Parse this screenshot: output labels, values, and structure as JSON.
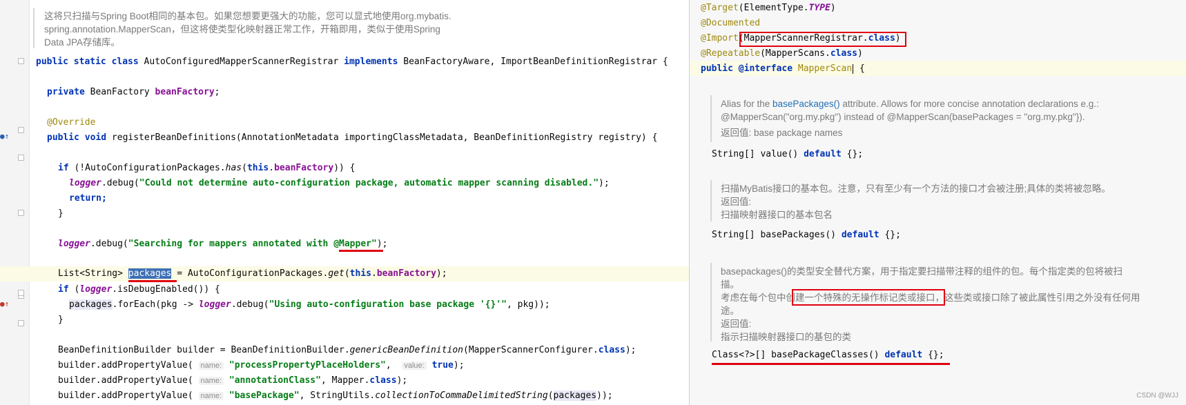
{
  "left_doc": {
    "line1": "这将只扫描与Spring Boot相同的基本包。如果您想要更强大的功能，您可以显式地使用org.mybatis.",
    "line2": "spring.annotation.MapperScan，但这将使类型化映射器正常工作，开箱即用，类似于使用Spring",
    "line3": "Data JPA存储库。"
  },
  "code": {
    "class_decl": {
      "k1": "public static class",
      "name": "AutoConfiguredMapperScannerRegistrar",
      "k2": "implements",
      "rest": "BeanFactoryAware, ImportBeanDefinitionRegistrar {"
    },
    "field": {
      "k": "private",
      "type": "BeanFactory",
      "name": "beanFactory",
      "end": ";"
    },
    "override": "@Override",
    "method_decl": {
      "k": "public void",
      "rest": "registerBeanDefinitions(AnnotationMetadata importingClassMetadata, BeanDefinitionRegistry registry) {"
    },
    "if1": {
      "k": "if",
      "a": "(!AutoConfigurationPackages.",
      "m": "has",
      "b": "(",
      "this": "this",
      "dot": ".",
      "f": "beanFactory",
      "c": ")) {"
    },
    "debug1": {
      "logger": "logger",
      "a": ".debug(",
      "s": "\"Could not determine auto-configuration package, automatic mapper scanning disabled.\"",
      "b": ");"
    },
    "return": "return;",
    "close1": "}",
    "debug2": {
      "logger": "logger",
      "a": ".debug(",
      "s1": "\"Searching for mappers annotated with ",
      "s2": "@Mapper",
      "s3": "\"",
      "b": ");"
    },
    "list": {
      "a": "List<String> ",
      "v": "packages",
      "b": " = AutoConfigurationPackages.",
      "m": "get",
      "c": "(",
      "this": "this",
      "dot": ".",
      "f": "beanFactory",
      "d": ");"
    },
    "if2": {
      "k": "if",
      "a": " (",
      "logger": "logger",
      "b": ".isDebugEnabled()) {"
    },
    "foreach": {
      "v": "packages",
      "a": ".forEach(pkg -> ",
      "logger": "logger",
      "b": ".debug(",
      "s": "\"Using auto-configuration base package '{}'\"",
      "c": ", pkg));"
    },
    "close2": "}",
    "builder1": {
      "a": "BeanDefinitionBuilder builder = BeanDefinitionBuilder.",
      "m": "genericBeanDefinition",
      "b": "(MapperScannerConfigurer.",
      "k": "class",
      "c": ");"
    },
    "builder2": {
      "a": "builder.addPropertyValue( ",
      "h1": "name:",
      "s": "\"processPropertyPlaceHolders\"",
      "sep": ",  ",
      "h2": "value:",
      "k": "true",
      "b": ");"
    },
    "builder3": {
      "a": "builder.addPropertyValue( ",
      "h1": "name:",
      "s": "\"annotationClass\"",
      "b": ", Mapper.",
      "k": "class",
      "c": ");"
    },
    "builder4": {
      "a": "builder.addPropertyValue( ",
      "h1": "name:",
      "s": "\"basePackage\"",
      "b": ", StringUtils.",
      "m": "collectionToCommaDelimitedString",
      "c": "(",
      "v": "packages",
      "d": "));"
    }
  },
  "right": {
    "ann1": {
      "a": "@Target",
      "b": "(ElementType.",
      "c": "TYPE",
      "d": ")"
    },
    "ann2": "@Documented",
    "ann3": {
      "a": "@Import",
      "b": "(MapperScannerRegistrar.",
      "k": "class",
      "c": ")"
    },
    "ann4": {
      "a": "@Repeatable",
      "b": "(MapperScans.",
      "k": "class",
      "c": ")"
    },
    "decl": {
      "k": "public",
      "at": "@interface",
      "name": "MapperScan",
      "brace": "{"
    },
    "doc1": {
      "a": "Alias for the ",
      "link": "basePackages()",
      "b": " attribute. Allows for more concise annotation declarations e.g.:",
      "line2": "@MapperScan(\"org.my.pkg\") instead of @MapperScan(basePackages = \"org.my.pkg\"}).",
      "line3": "返回值: base package names"
    },
    "m1": {
      "a": "String[] value() ",
      "k": "default",
      "b": " {};"
    },
    "doc2": {
      "line1": "扫描MyBatis接口的基本包。注意，只有至少有一个方法的接口才会被注册;具体的类将被忽略。",
      "line2": "返回值:",
      "line3": "扫描映射器接口的基本包名"
    },
    "m2": {
      "a": "String[] basePackages() ",
      "k": "default",
      "b": " {};"
    },
    "doc3": {
      "line1": "basepackages()的类型安全替代方案，用于指定要扫描带注释的组件的包。每个指定类的包将被扫",
      "line2": "描。",
      "line3a": "考虑在每个包中创",
      "line3b": "建一个特殊的无操作标记类或接口",
      "line3c": "，这些类或接口除了被此属性引用之外没有任何用",
      "line4": "途。",
      "line5": "返回值:",
      "line6": "指示扫描映射器接口的基包的类"
    },
    "m3": {
      "a": "Class<?>[] basePackageClasses() ",
      "k": "default",
      "b": " {};"
    },
    "watermark": "CSDN @WJJ"
  },
  "colors": {
    "keyword": "#0033b3",
    "string": "#067d17",
    "field": "#871094",
    "annotation": "#9e880d",
    "markup_red": "#e0000f"
  }
}
